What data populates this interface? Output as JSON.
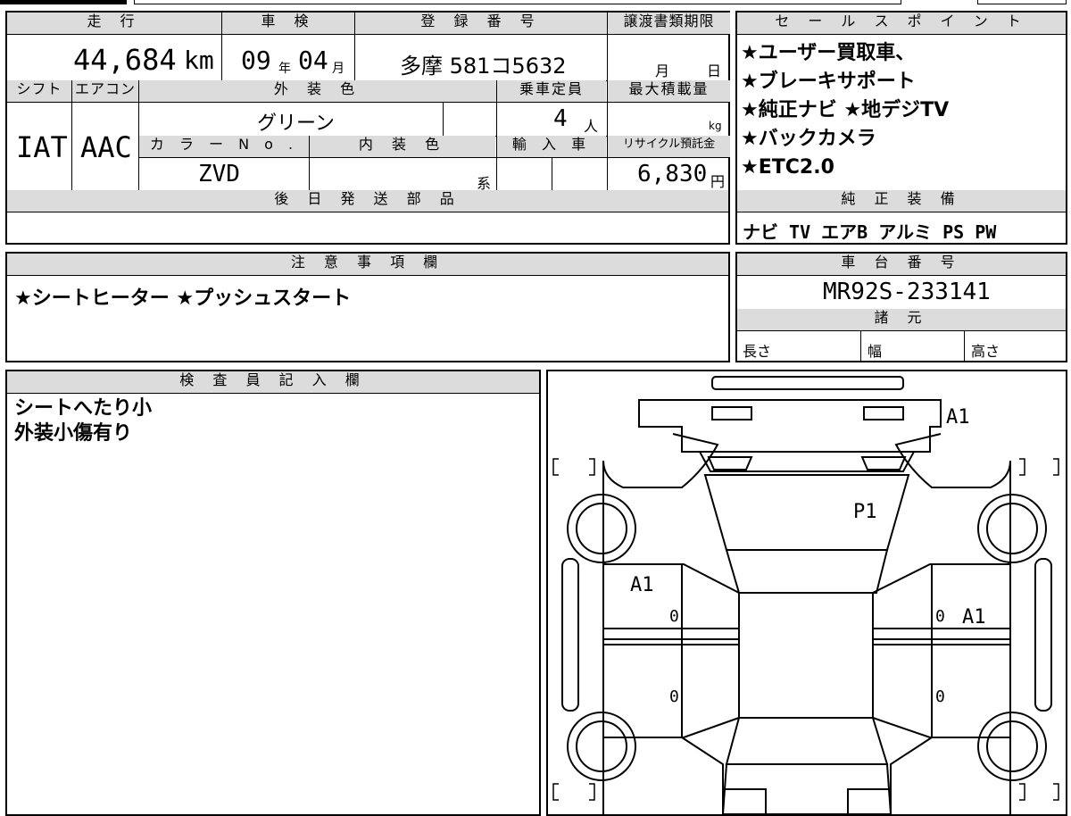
{
  "headers": {
    "mileage": "走 行",
    "inspection": "車 検",
    "registration": "登 録 番 号",
    "transfer_deadline": "譲渡書類期限",
    "shift": "シフト",
    "aircon": "エアコン",
    "exterior_color": "外 装 色",
    "capacity": "乗車定員",
    "max_load": "最大積載量",
    "color_no": "カ ラ ー N o .",
    "interior_color": "内 装 色",
    "import": "輸 入 車",
    "recycle": "リサイクル預託金",
    "later_parts": "後 日 発 送 部 品",
    "sales_point": "セ ー ル ス ポ イ ン ト",
    "genuine_equipment": "純 正 装 備",
    "notes": "注 意 事 項 欄",
    "chassis_no": "車 台 番 号",
    "specs": "諸 元",
    "inspector": "検 査 員 記 入 欄"
  },
  "values": {
    "mileage": "44,684",
    "mileage_unit": "km",
    "inspection_year": "09",
    "year_unit": "年",
    "inspection_month": "04",
    "month_unit": "月",
    "registration": "多摩 581コ5632",
    "transfer_month_unit": "月",
    "transfer_day_unit": "日",
    "shift": "IAT",
    "aircon": "AAC",
    "exterior_color": "グリーン",
    "capacity": "4",
    "capacity_unit": "人",
    "load_unit": "kg",
    "color_no": "ZVD",
    "interior_suffix": "系",
    "recycle": "6,830",
    "recycle_unit": "円"
  },
  "sales_points": [
    "★ユーザー買取車、",
    "★ブレーキサポート",
    "★純正ナビ ★地デジTV",
    "★バックカメラ",
    "★ETC2.0"
  ],
  "genuine_equipment": "ナビ TV エアB アルミ PS PW",
  "notes": "★シートヒーター ★プッシュスタート",
  "chassis_no": "MR92S-233141",
  "specs": {
    "length": "長さ",
    "width": "幅",
    "height": "高さ"
  },
  "inspector_notes": [
    "シートへたり小",
    "外装小傷有り"
  ],
  "diagram_marks": {
    "top_right": "A1",
    "hood": "P1",
    "left_front_door": "A1",
    "right_front_door": "A1",
    "left_front_zero": "0",
    "left_rear_zero": "0",
    "right_front_zero": "0",
    "right_rear_zero": "0"
  }
}
